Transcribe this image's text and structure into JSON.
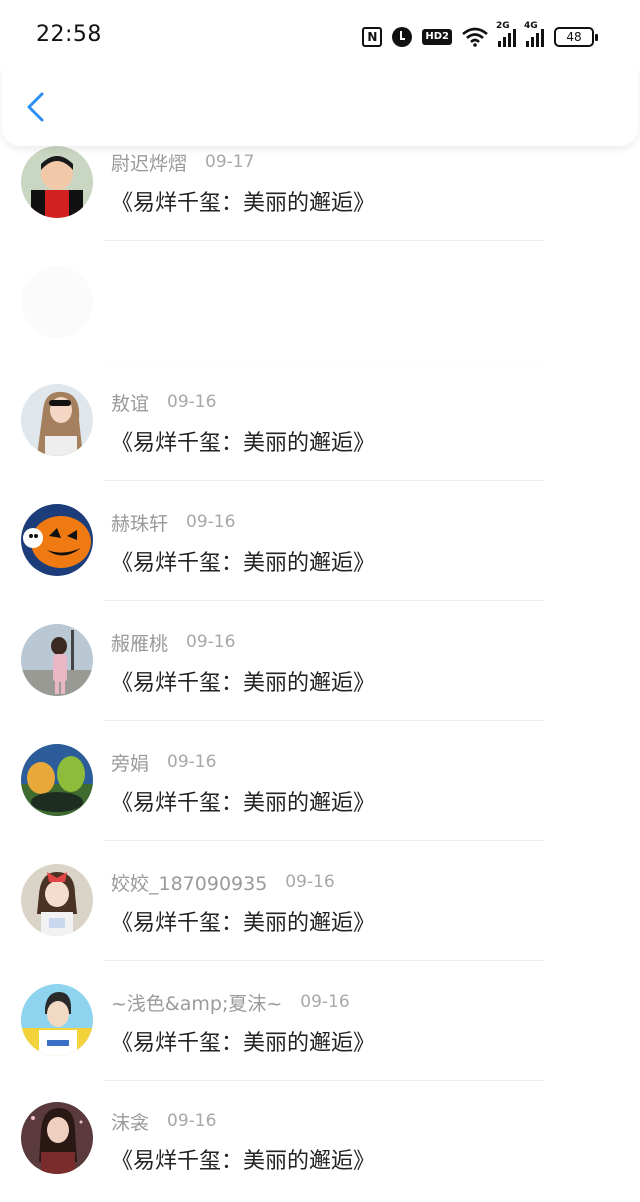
{
  "status_bar": {
    "time": "22:58",
    "nfc": "N",
    "hd": "HD2",
    "net1": "2G",
    "net2": "4G",
    "battery": "48"
  },
  "header": {
    "back_icon": "chevron-left-icon",
    "accent_color": "#2a8ef2"
  },
  "comments": [
    {
      "name": "尉迟烨熠",
      "date": "09-17",
      "text": "《易烊千玺：美丽的邂逅》",
      "avatar": "boy-red-shirt"
    },
    {
      "name": "",
      "date": "",
      "text": "",
      "avatar": "faded"
    },
    {
      "name": "敖谊",
      "date": "09-16",
      "text": "《易烊千玺：美丽的邂逅》",
      "avatar": "girl-sunglasses"
    },
    {
      "name": "赫珠轩",
      "date": "09-16",
      "text": "《易烊千玺：美丽的邂逅》",
      "avatar": "pumpkin"
    },
    {
      "name": "赧雁桃",
      "date": "09-16",
      "text": "《易烊千玺：美丽的邂逅》",
      "avatar": "girl-street"
    },
    {
      "name": "旁娟",
      "date": "09-16",
      "text": "《易烊千玺：美丽的邂逅》",
      "avatar": "landscape"
    },
    {
      "name": "姣姣_187090935",
      "date": "09-16",
      "text": "《易烊千玺：美丽的邂逅》",
      "avatar": "girl-bow"
    },
    {
      "name": "~浅色&amp;夏沫~",
      "date": "09-16",
      "text": "《易烊千玺：美丽的邂逅》",
      "avatar": "boy-yellow"
    },
    {
      "name": "沫衾",
      "date": "09-16",
      "text": "《易烊千玺：美丽的邂逅》",
      "avatar": "girl-dark"
    }
  ]
}
